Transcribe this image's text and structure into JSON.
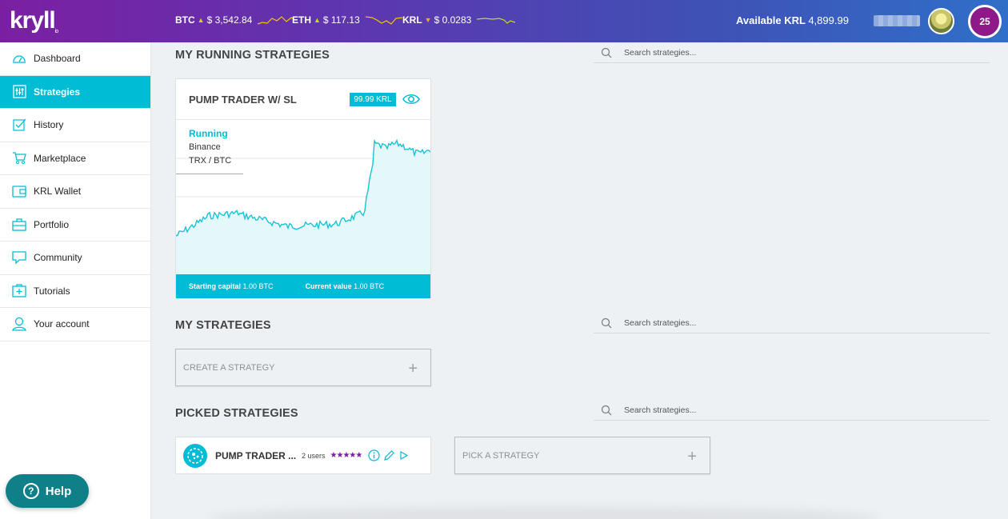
{
  "topbar": {
    "logo_text": "kryll",
    "logo_suffix": "io",
    "tickers": [
      {
        "symbol": "BTC",
        "direction": "up",
        "value": "$ 3,542.84"
      },
      {
        "symbol": "ETH",
        "direction": "up",
        "value": "$ 117.13"
      },
      {
        "symbol": "KRL",
        "direction": "down",
        "value": "$ 0.0283"
      }
    ],
    "available_label": "Available KRL",
    "available_value": "4,899.99",
    "notification_count": "25"
  },
  "sidebar": {
    "items": [
      {
        "label": "Dashboard",
        "icon": "dashboard-icon",
        "active": false
      },
      {
        "label": "Strategies",
        "icon": "strategies-icon",
        "active": true
      },
      {
        "label": "History",
        "icon": "history-icon",
        "active": false
      },
      {
        "label": "Marketplace",
        "icon": "cart-icon",
        "active": false
      },
      {
        "label": "KRL Wallet",
        "icon": "wallet-icon",
        "active": false
      },
      {
        "label": "Portfolio",
        "icon": "briefcase-icon",
        "active": false
      },
      {
        "label": "Community",
        "icon": "chat-icon",
        "active": false
      },
      {
        "label": "Tutorials",
        "icon": "tutorials-icon",
        "active": false
      },
      {
        "label": "Your account",
        "icon": "user-icon",
        "active": false
      }
    ],
    "help_label": "Help"
  },
  "running": {
    "title": "MY RUNNING STRATEGIES",
    "search_placeholder": "Search strategies...",
    "card": {
      "name": "PUMP TRADER W/ SL",
      "price": "99.99 KRL",
      "status": "Running",
      "exchange": "Binance",
      "pair": "TRX / BTC",
      "starting_label": "Starting capital",
      "starting_value": "1.00 BTC",
      "current_label": "Current value",
      "current_value": "1.00 BTC"
    }
  },
  "my_strategies": {
    "title": "MY STRATEGIES",
    "search_placeholder": "Search strategies...",
    "create_label": "CREATE A STRATEGY"
  },
  "picked": {
    "title": "PICKED STRATEGIES",
    "search_placeholder": "Search strategies...",
    "item": {
      "name": "PUMP TRADER ...",
      "users": "2 users",
      "rating": "★★★★★"
    },
    "pick_label": "PICK A STRATEGY"
  },
  "colors": {
    "accent": "#00bcd4",
    "brand_purple": "#7b1fa2",
    "badge": "#8e1a8a"
  }
}
